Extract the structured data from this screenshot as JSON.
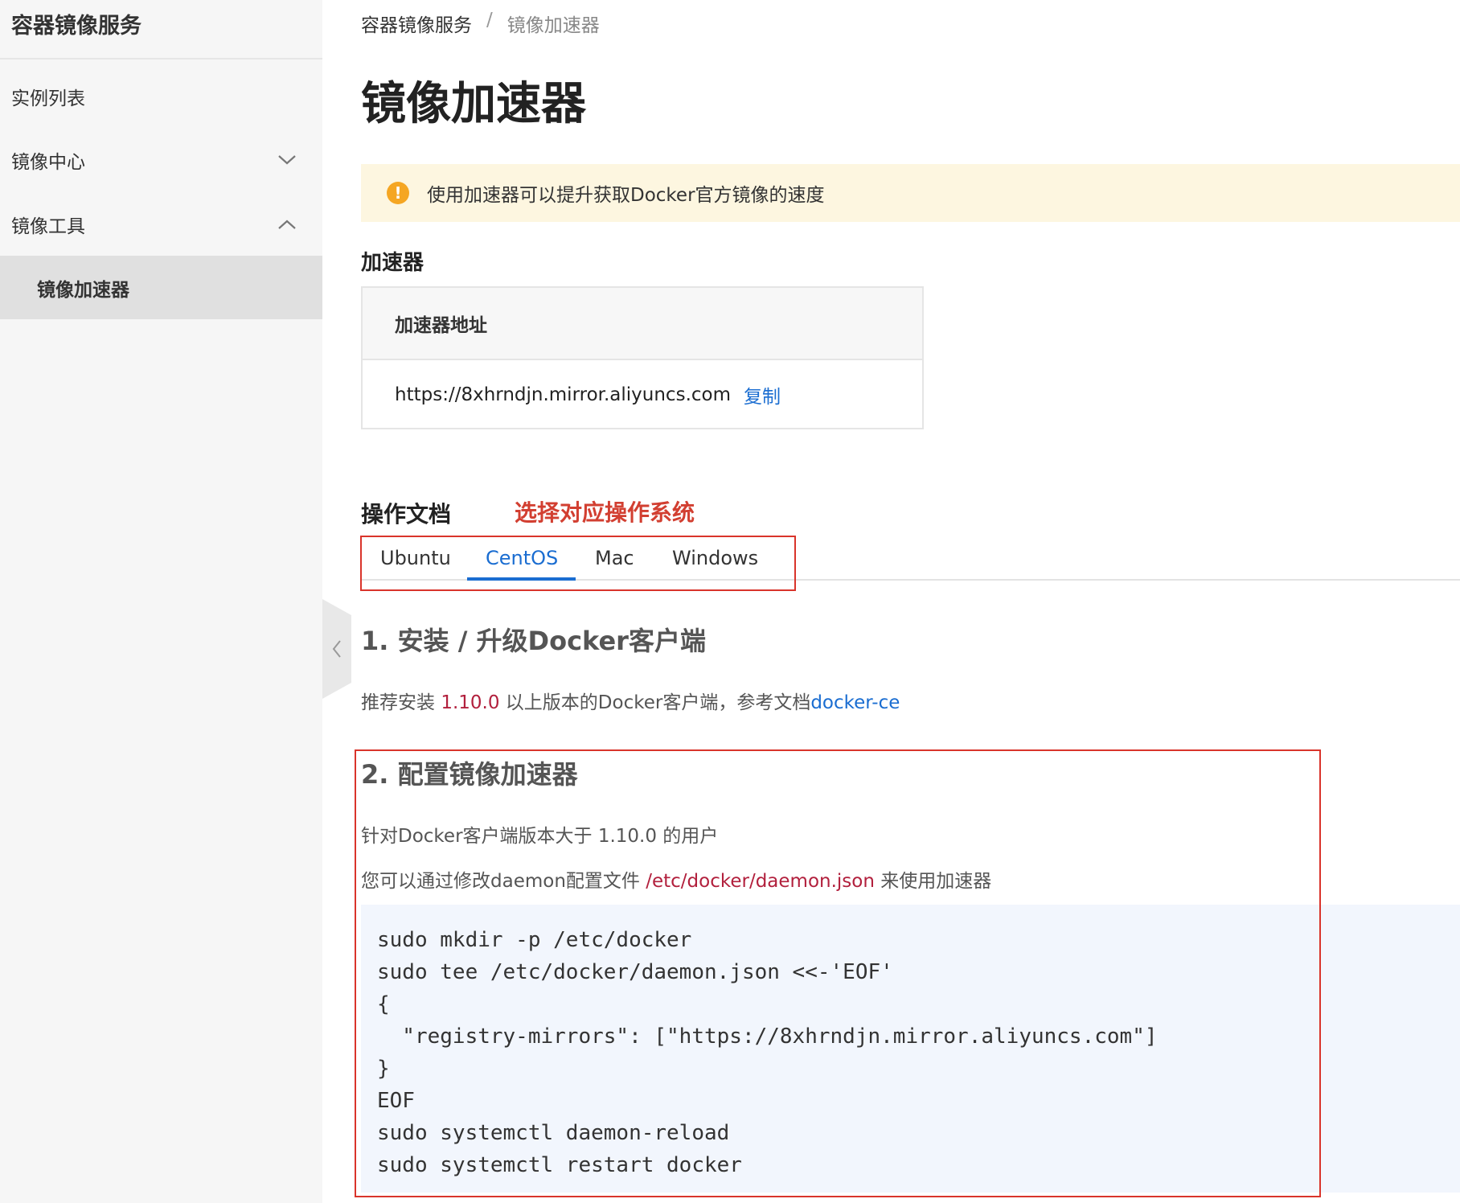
{
  "sidebar": {
    "title": "容器镜像服务",
    "items": [
      {
        "label": "实例列表"
      },
      {
        "label": "镜像中心"
      },
      {
        "label": "镜像工具"
      },
      {
        "label": "镜像加速器"
      }
    ]
  },
  "breadcrumb": {
    "root": "容器镜像服务",
    "separator": "/",
    "current": "镜像加速器"
  },
  "page_title": "镜像加速器",
  "notice": {
    "icon": "!",
    "text": "使用加速器可以提升获取Docker官方镜像的速度"
  },
  "accelerator": {
    "label": "加速器",
    "column_header": "加速器地址",
    "address": "https://8xhrndjn.mirror.aliyuncs.com",
    "copy_label": "复制"
  },
  "docs": {
    "label": "操作文档",
    "hint": "选择对应操作系统",
    "tabs": [
      "Ubuntu",
      "CentOS",
      "Mac",
      "Windows"
    ],
    "active_tab": "CentOS"
  },
  "step1": {
    "title": "1. 安装 / 升级Docker客户端",
    "text_before": "推荐安装",
    "version": "1.10.0",
    "text_after": "以上版本的Docker客户端，参考文档",
    "link": "docker-ce"
  },
  "step2": {
    "title": "2. 配置镜像加速器",
    "line1": "针对Docker客户端版本大于 1.10.0 的用户",
    "line2_before": "您可以通过修改daemon配置文件",
    "line2_path": "/etc/docker/daemon.json",
    "line2_after": "来使用加速器",
    "code": [
      "sudo mkdir -p /etc/docker",
      "sudo tee /etc/docker/daemon.json <<-'EOF'",
      "{",
      "  \"registry-mirrors\": [\"https://8xhrndjn.mirror.aliyuncs.com\"]",
      "}",
      "EOF",
      "sudo systemctl daemon-reload",
      "sudo systemctl restart docker"
    ]
  },
  "colors": {
    "accent": "#1a6dd1",
    "highlight_red": "#d9342b",
    "code_red": "#b2203d",
    "notice_bg": "#fdf6e0",
    "notice_icon": "#f5a623"
  }
}
